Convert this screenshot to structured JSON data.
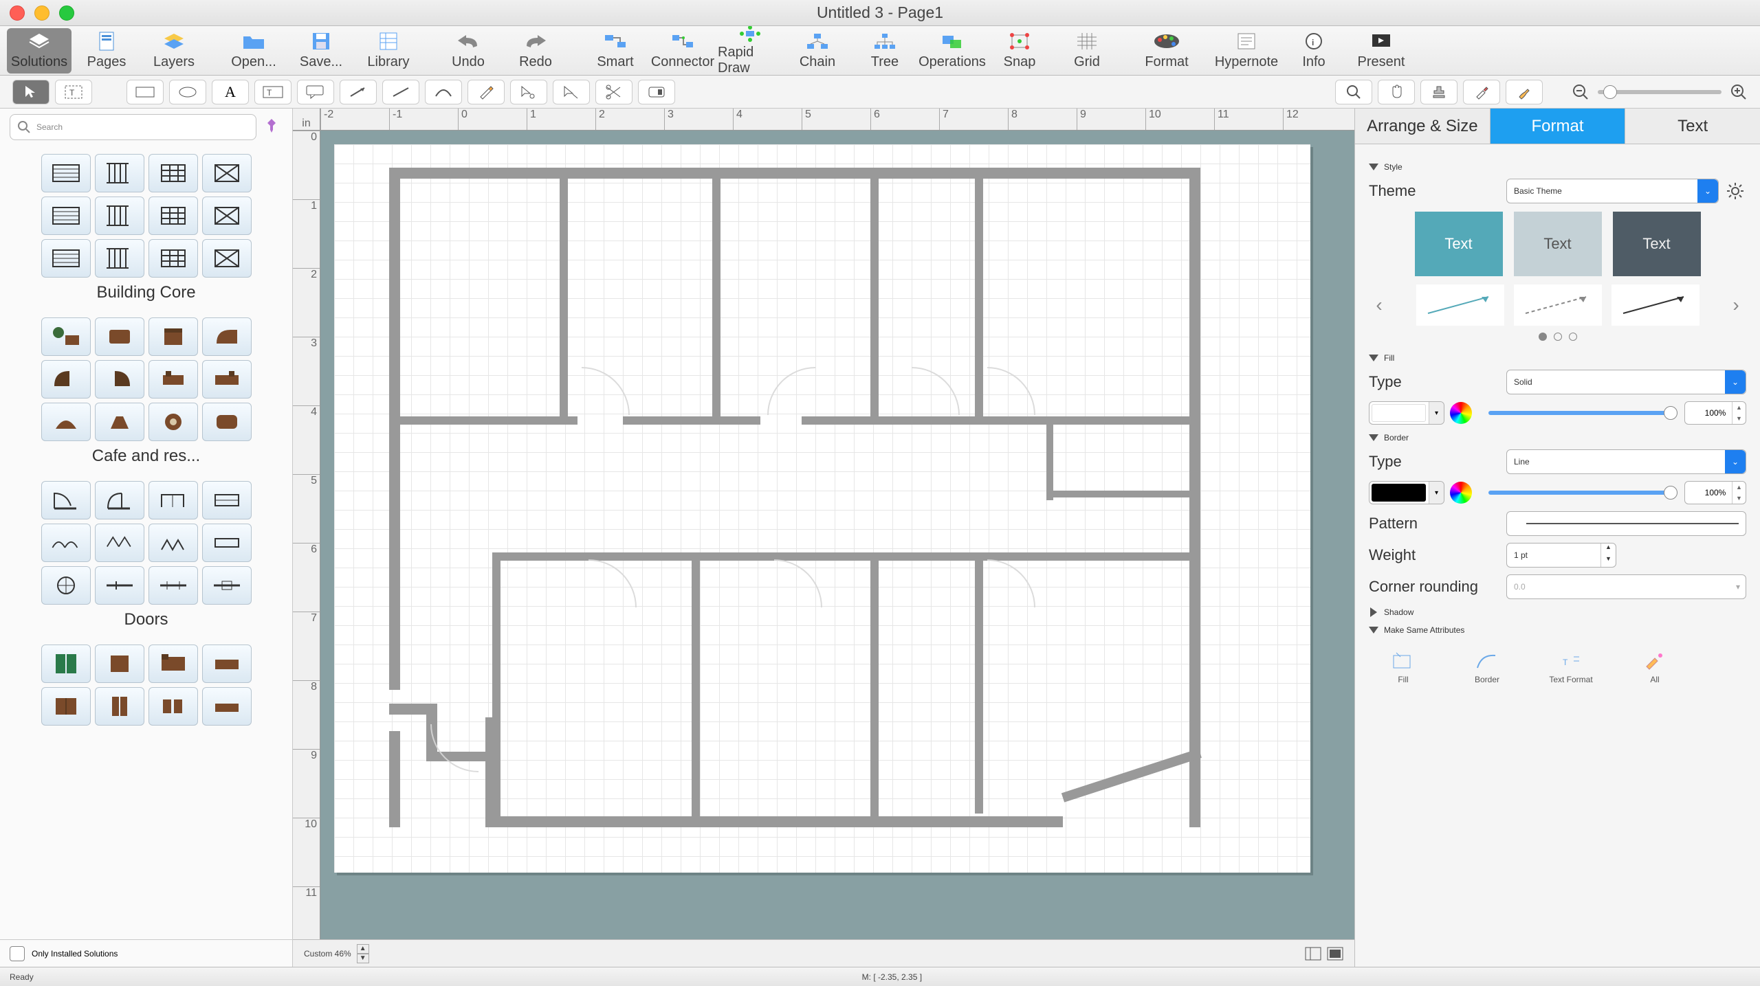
{
  "title": "Untitled 3 - Page1",
  "toolbar": [
    {
      "id": "solutions",
      "label": "Solutions"
    },
    {
      "id": "pages",
      "label": "Pages"
    },
    {
      "id": "layers",
      "label": "Layers"
    },
    {
      "id": "open",
      "label": "Open..."
    },
    {
      "id": "save",
      "label": "Save..."
    },
    {
      "id": "library",
      "label": "Library"
    },
    {
      "id": "undo",
      "label": "Undo"
    },
    {
      "id": "redo",
      "label": "Redo"
    },
    {
      "id": "smart",
      "label": "Smart"
    },
    {
      "id": "connector",
      "label": "Connector"
    },
    {
      "id": "rapid",
      "label": "Rapid Draw"
    },
    {
      "id": "chain",
      "label": "Chain"
    },
    {
      "id": "tree",
      "label": "Tree"
    },
    {
      "id": "operations",
      "label": "Operations"
    },
    {
      "id": "snap",
      "label": "Snap"
    },
    {
      "id": "grid",
      "label": "Grid"
    },
    {
      "id": "format",
      "label": "Format"
    },
    {
      "id": "hypernote",
      "label": "Hypernote"
    },
    {
      "id": "info",
      "label": "Info"
    },
    {
      "id": "present",
      "label": "Present"
    }
  ],
  "search": {
    "placeholder": "Search"
  },
  "libraries": [
    {
      "name": "Building Core",
      "cells": 12
    },
    {
      "name": "Cafe and res...",
      "cells": 12
    },
    {
      "name": "Doors",
      "cells": 12
    }
  ],
  "library4": {
    "cells_partial": 8
  },
  "only_installed": "Only Installed Solutions",
  "ruler_h": [
    "-2",
    "-1",
    "0",
    "1",
    "2",
    "3",
    "4",
    "5",
    "6",
    "7",
    "8",
    "9",
    "10",
    "11",
    "12"
  ],
  "ruler_v": [
    "0",
    "1",
    "2",
    "3",
    "4",
    "5",
    "6",
    "7",
    "8",
    "9",
    "10",
    "11"
  ],
  "ruler_unit": "in",
  "zoom_label": "Custom 46%",
  "right_panel": {
    "tabs": [
      "Arrange & Size",
      "Format",
      "Text"
    ],
    "active_tab": 1,
    "style": {
      "header": "Style",
      "theme_label": "Theme",
      "theme_value": "Basic Theme",
      "sample_text": "Text"
    },
    "fill": {
      "header": "Fill",
      "type_label": "Type",
      "type_value": "Solid",
      "pct": "100%",
      "fill_color": "#ffffff"
    },
    "border": {
      "header": "Border",
      "type_label": "Type",
      "type_value": "Line",
      "pct": "100%",
      "pattern_label": "Pattern",
      "weight_label": "Weight",
      "weight_value": "1 pt",
      "corner_label": "Corner rounding",
      "corner_value": "0.0",
      "border_color": "#000000"
    },
    "shadow": {
      "header": "Shadow"
    },
    "same": {
      "header": "Make Same Attributes",
      "items": [
        "Fill",
        "Border",
        "Text Format",
        "All"
      ]
    }
  },
  "status": {
    "ready": "Ready",
    "mouse": "M: [ -2.35, 2.35 ]"
  }
}
